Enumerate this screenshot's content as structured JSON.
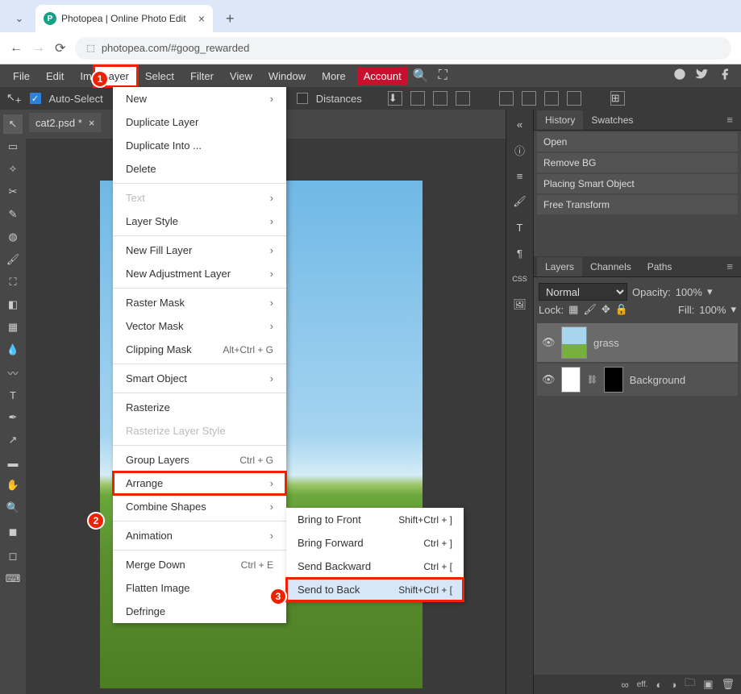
{
  "browser": {
    "tab_title": "Photopea | Online Photo Edit",
    "url": "photopea.com/#goog_rewarded"
  },
  "menu": {
    "file": "File",
    "edit": "Edit",
    "image": "Image",
    "layer": "Layer",
    "select": "Select",
    "filter": "Filter",
    "view": "View",
    "window": "Window",
    "more": "More",
    "account": "Account"
  },
  "opts": {
    "auto_select": "Auto-Select",
    "distances": "Distances"
  },
  "doc_tab": "cat2.psd *",
  "dd1": {
    "new": "New",
    "dup": "Duplicate Layer",
    "dupinto": "Duplicate Into ...",
    "del": "Delete",
    "text": "Text",
    "style": "Layer Style",
    "fill": "New Fill Layer",
    "adj": "New Adjustment Layer",
    "rmask": "Raster Mask",
    "vmask": "Vector Mask",
    "cmask": "Clipping Mask",
    "cmask_sc": "Alt+Ctrl + G",
    "smart": "Smart Object",
    "rasterize": "Rasterize",
    "rasterize_ls": "Rasterize Layer Style",
    "group": "Group Layers",
    "group_sc": "Ctrl + G",
    "arrange": "Arrange",
    "combine": "Combine Shapes",
    "anim": "Animation",
    "merge": "Merge Down",
    "merge_sc": "Ctrl + E",
    "flatten": "Flatten Image",
    "defringe": "Defringe"
  },
  "dd2": {
    "bfront": "Bring to Front",
    "bfront_sc": "Shift+Ctrl + ]",
    "bfwd": "Bring Forward",
    "bfwd_sc": "Ctrl + ]",
    "sback": "Send Backward",
    "sback_sc": "Ctrl + [",
    "stback": "Send to Back",
    "stback_sc": "Shift+Ctrl + ["
  },
  "panels": {
    "history": "History",
    "swatches": "Swatches",
    "layers": "Layers",
    "channels": "Channels",
    "paths": "Paths"
  },
  "history": [
    "Open",
    "Remove BG",
    "Placing Smart Object",
    "Free Transform"
  ],
  "layers_opts": {
    "blend": "Normal",
    "opacity_label": "Opacity:",
    "opacity": "100%",
    "lock": "Lock:",
    "fill_label": "Fill:",
    "fill": "100%"
  },
  "layers": {
    "l1": "grass",
    "l2": "Background"
  },
  "badges": {
    "b1": "1",
    "b2": "2",
    "b3": "3"
  }
}
